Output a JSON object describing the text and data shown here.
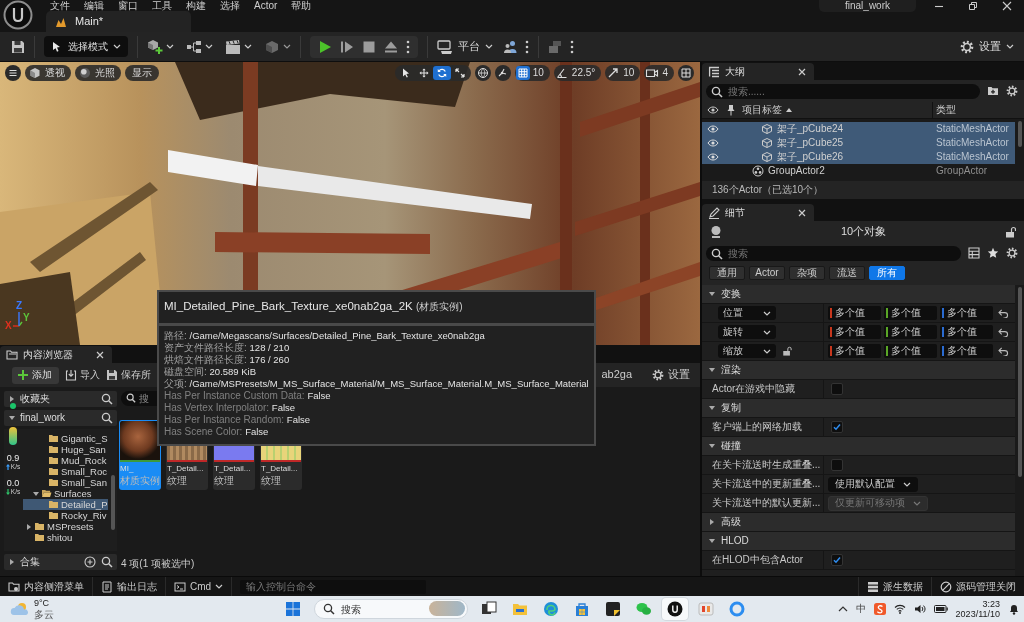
{
  "title_bar": {
    "menu": [
      "文件",
      "编辑",
      "窗口",
      "工具",
      "构建",
      "选择",
      "Actor",
      "帮助"
    ],
    "tab": "Main*",
    "project": "final_work"
  },
  "toolbar": {
    "mode": "选择模式",
    "platform": "平台",
    "settings": "设置"
  },
  "viewport": {
    "view_buttons": [
      {
        "kind": "perspective",
        "label": "透视"
      },
      {
        "kind": "lighting",
        "label": "光照"
      },
      {
        "kind": "show",
        "label": "显示"
      }
    ],
    "transform_tools": [
      {
        "kind": "select",
        "selected": false
      },
      {
        "kind": "move",
        "selected": false
      },
      {
        "kind": "rotate",
        "selected": true
      },
      {
        "kind": "scale",
        "selected": false
      }
    ],
    "snaps": [
      {
        "kind": "grid",
        "value": "10",
        "on": true
      },
      {
        "kind": "angle",
        "value": "22.5°",
        "on": false
      },
      {
        "kind": "scale",
        "value": "10",
        "on": false
      },
      {
        "kind": "camera",
        "value": "4",
        "on": false
      }
    ],
    "axes": [
      {
        "label": "X",
        "color": "#e0301e"
      },
      {
        "label": "Y",
        "color": "#5cc43a"
      },
      {
        "label": "Z",
        "color": "#3a78ff"
      }
    ]
  },
  "outliner": {
    "title": "大纲",
    "search": {
      "placeholder": "搜索......"
    },
    "columns": [
      {
        "label": "项目标签",
        "sorted": true
      },
      {
        "label": "类型",
        "sorted": false
      }
    ],
    "rows": [
      {
        "children": [
          {
            "label": "架子_pCube24",
            "type": "StaticMeshActor",
            "kind": "mesh",
            "selected": true
          },
          {
            "label": "架子_pCube25",
            "type": "StaticMeshActor",
            "kind": "mesh",
            "selected": true
          },
          {
            "label": "架子_pCube26",
            "type": "StaticMeshActor",
            "kind": "mesh",
            "selected": true
          }
        ]
      },
      {
        "label": "GroupActor2",
        "type": "GroupActor",
        "kind": "group",
        "selected": false
      }
    ],
    "status": "136个Actor（已选10个）"
  },
  "details": {
    "title": "细节",
    "object_count": "10个对象",
    "search": {
      "placeholder": "搜索"
    },
    "filters": [
      {
        "label": "通用",
        "selected": false
      },
      {
        "label": "Actor",
        "selected": false
      },
      {
        "label": "杂项",
        "selected": false
      },
      {
        "label": "流送",
        "selected": false
      },
      {
        "label": "所有",
        "selected": true
      }
    ],
    "sections": [
      {
        "title": "变换",
        "expanded": true,
        "rows": [
          {
            "kind": "vector",
            "label": "位置",
            "values": [
              {
                "text": "多个值",
                "color": "#c8371d"
              },
              {
                "text": "多个值",
                "color": "#5aa626"
              },
              {
                "text": "多个值",
                "color": "#2a6bd1"
              }
            ]
          },
          {
            "kind": "vector",
            "label": "旋转",
            "values": [
              {
                "text": "多个值",
                "color": "#c8371d"
              },
              {
                "text": "多个值",
                "color": "#5aa626"
              },
              {
                "text": "多个值",
                "color": "#2a6bd1"
              }
            ]
          },
          {
            "kind": "vector",
            "label": "缩放",
            "locked": false,
            "values": [
              {
                "text": "多个值",
                "color": "#c8371d"
              },
              {
                "text": "多个值",
                "color": "#5aa626"
              },
              {
                "text": "多个值",
                "color": "#2a6bd1"
              }
            ]
          }
        ]
      },
      {
        "title": "渲染",
        "expanded": true,
        "rows": [
          {
            "kind": "checkbox",
            "label": "Actor在游戏中隐藏",
            "checked": false
          }
        ]
      },
      {
        "title": "复制",
        "expanded": true,
        "rows": [
          {
            "kind": "checkbox",
            "label": "客户端上的网络加载",
            "checked": true
          }
        ]
      },
      {
        "title": "碰撞",
        "expanded": true,
        "rows": [
          {
            "kind": "checkbox",
            "label": "在关卡流送时生成重叠...",
            "checked": false
          },
          {
            "kind": "select",
            "label": "关卡流送中的更新重叠...",
            "value": "使用默认配置",
            "disabled": false
          },
          {
            "kind": "select",
            "label": "关卡流送中的默认更新...",
            "value": "仅更新可移动项",
            "disabled": true
          }
        ]
      },
      {
        "title": "高级",
        "expanded": false
      },
      {
        "title": "HLOD",
        "expanded": true,
        "rows": [
          {
            "kind": "checkbox",
            "label": "在HLOD中包含Actor",
            "checked": true
          }
        ]
      }
    ]
  },
  "tooltip": {
    "title": "MI_Detailed_Pine_Bark_Texture_xe0nab2ga_2K",
    "title_suffix": "(材质实例)",
    "lines": [
      {
        "kind": "detail",
        "key": "路径:",
        "value": "/Game/Megascans/Surfaces/Detailed_Pine_Bark_Texture_xe0nab2ga"
      },
      {
        "kind": "detail",
        "key": "资产文件路径长度:",
        "value": "128 / 210"
      },
      {
        "kind": "detail",
        "key": "烘焙文件路径长度:",
        "value": "176 / 260"
      },
      {
        "kind": "detail",
        "key": "磁盘空间:",
        "value": "20.589 KiB"
      },
      {
        "kind": "detail",
        "key": "父项:",
        "value": "/Game/MSPresets/M_MS_Surface_Material/M_MS_Surface_Material.M_MS_Surface_Material"
      },
      {
        "kind": "flag",
        "key": "Has Per Instance Custom Data:",
        "value": "False"
      },
      {
        "kind": "flag",
        "key": "Has Vertex Interpolator:",
        "value": "False"
      },
      {
        "kind": "flag",
        "key": "Has Per Instance Random:",
        "value": "False"
      },
      {
        "kind": "flag",
        "key": "Has Scene Color:",
        "value": "False"
      }
    ]
  },
  "content_browser": {
    "title": "内容浏览器",
    "actions": [
      {
        "kind": "add",
        "label": "添加"
      },
      {
        "kind": "import",
        "label": "导入"
      },
      {
        "kind": "save",
        "label": "保存所"
      }
    ],
    "path": "ab2ga",
    "settings": "设置",
    "sources": [
      {
        "label": "收藏夹",
        "expanded": false
      },
      {
        "label": "final_work",
        "expanded": true
      }
    ],
    "tree": [
      {
        "children": [
          {
            "children": [
              {
                "label": "Gigantic_S",
                "selected": false
              },
              {
                "label": "Huge_San",
                "selected": false
              },
              {
                "label": "Mud_Rock",
                "selected": false
              },
              {
                "label": "Small_Roc",
                "selected": false
              },
              {
                "label": "Small_San",
                "selected": false
              }
            ]
          },
          {
            "label": "Surfaces",
            "expanded": true,
            "selected": false,
            "children": [
              {
                "label": "Detailed_P",
                "selected": true
              },
              {
                "label": "Rocky_Riv",
                "selected": false
              }
            ]
          }
        ]
      },
      {
        "label": "MSPresets",
        "expanded": false,
        "selected": false
      },
      {
        "label": "shitou",
        "selected": false
      }
    ],
    "collections": {
      "label": "合集",
      "expanded": false
    },
    "search": {
      "placeholder": "搜"
    },
    "assets": [
      {
        "name": "MI_",
        "type": "材质实例",
        "kind": "material",
        "color": "#3c9a3c",
        "selected": true
      },
      {
        "name": "T_Detail...",
        "type": "纹理",
        "kind": "albedo",
        "color": "#c02828",
        "selected": false
      },
      {
        "name": "T_Detail...",
        "type": "纹理",
        "kind": "normal",
        "color": "#c02828",
        "selected": false
      },
      {
        "name": "T_Detail...",
        "type": "纹理",
        "kind": "mask",
        "color": "#c02828",
        "selected": false
      }
    ],
    "status": "4 项(1 项被选中)"
  },
  "network_widget": {
    "upload": {
      "value": "0.9",
      "unit": "K/s"
    },
    "download": {
      "value": "0.0",
      "unit": "K/s"
    }
  },
  "bottom_bar": {
    "left": [
      {
        "kind": "drawer",
        "label": "内容侧滑菜单"
      },
      {
        "kind": "log",
        "label": "输出日志"
      },
      {
        "kind": "cmd",
        "label": "Cmd"
      }
    ],
    "console": {
      "placeholder": "输入控制台命令"
    },
    "right": [
      {
        "kind": "ddc",
        "label": "派生数据"
      },
      {
        "kind": "source_control",
        "label": "源码管理关闭"
      }
    ]
  },
  "taskbar": {
    "weather": {
      "temperature": "9°C",
      "condition": "多云"
    },
    "search": {
      "placeholder": "搜索"
    },
    "apps": [
      {
        "kind": "task_view",
        "active": false
      },
      {
        "kind": "files",
        "active": false
      },
      {
        "kind": "browser",
        "active": false
      },
      {
        "kind": "store",
        "active": false
      },
      {
        "kind": "notes",
        "active": false
      },
      {
        "kind": "chat",
        "active": false
      },
      {
        "kind": "engine",
        "active": true
      },
      {
        "kind": "photos",
        "active": false
      },
      {
        "kind": "ring",
        "active": false
      }
    ],
    "ime": "中",
    "time": "3:23",
    "date": "2023/11/10"
  }
}
